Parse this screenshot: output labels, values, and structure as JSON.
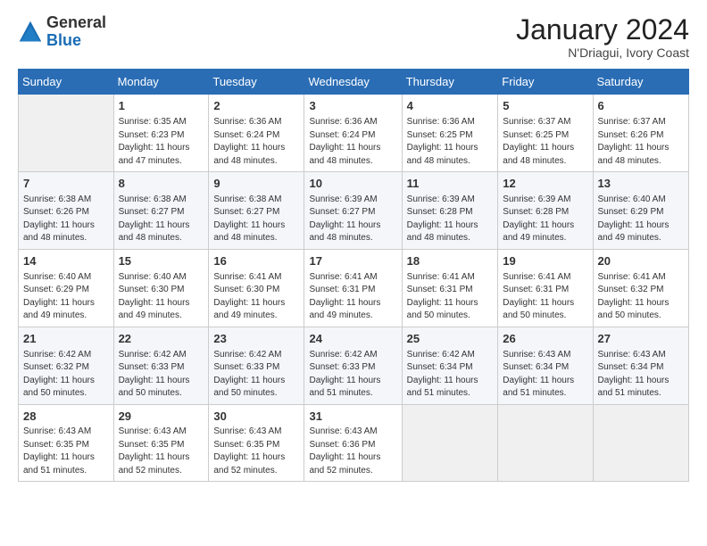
{
  "logo": {
    "general": "General",
    "blue": "Blue"
  },
  "title": "January 2024",
  "location": "N'Driagui, Ivory Coast",
  "headers": [
    "Sunday",
    "Monday",
    "Tuesday",
    "Wednesday",
    "Thursday",
    "Friday",
    "Saturday"
  ],
  "weeks": [
    [
      {
        "day": "",
        "info": ""
      },
      {
        "day": "1",
        "info": "Sunrise: 6:35 AM\nSunset: 6:23 PM\nDaylight: 11 hours\nand 47 minutes."
      },
      {
        "day": "2",
        "info": "Sunrise: 6:36 AM\nSunset: 6:24 PM\nDaylight: 11 hours\nand 48 minutes."
      },
      {
        "day": "3",
        "info": "Sunrise: 6:36 AM\nSunset: 6:24 PM\nDaylight: 11 hours\nand 48 minutes."
      },
      {
        "day": "4",
        "info": "Sunrise: 6:36 AM\nSunset: 6:25 PM\nDaylight: 11 hours\nand 48 minutes."
      },
      {
        "day": "5",
        "info": "Sunrise: 6:37 AM\nSunset: 6:25 PM\nDaylight: 11 hours\nand 48 minutes."
      },
      {
        "day": "6",
        "info": "Sunrise: 6:37 AM\nSunset: 6:26 PM\nDaylight: 11 hours\nand 48 minutes."
      }
    ],
    [
      {
        "day": "7",
        "info": "Sunrise: 6:38 AM\nSunset: 6:26 PM\nDaylight: 11 hours\nand 48 minutes."
      },
      {
        "day": "8",
        "info": "Sunrise: 6:38 AM\nSunset: 6:27 PM\nDaylight: 11 hours\nand 48 minutes."
      },
      {
        "day": "9",
        "info": "Sunrise: 6:38 AM\nSunset: 6:27 PM\nDaylight: 11 hours\nand 48 minutes."
      },
      {
        "day": "10",
        "info": "Sunrise: 6:39 AM\nSunset: 6:27 PM\nDaylight: 11 hours\nand 48 minutes."
      },
      {
        "day": "11",
        "info": "Sunrise: 6:39 AM\nSunset: 6:28 PM\nDaylight: 11 hours\nand 48 minutes."
      },
      {
        "day": "12",
        "info": "Sunrise: 6:39 AM\nSunset: 6:28 PM\nDaylight: 11 hours\nand 49 minutes."
      },
      {
        "day": "13",
        "info": "Sunrise: 6:40 AM\nSunset: 6:29 PM\nDaylight: 11 hours\nand 49 minutes."
      }
    ],
    [
      {
        "day": "14",
        "info": "Sunrise: 6:40 AM\nSunset: 6:29 PM\nDaylight: 11 hours\nand 49 minutes."
      },
      {
        "day": "15",
        "info": "Sunrise: 6:40 AM\nSunset: 6:30 PM\nDaylight: 11 hours\nand 49 minutes."
      },
      {
        "day": "16",
        "info": "Sunrise: 6:41 AM\nSunset: 6:30 PM\nDaylight: 11 hours\nand 49 minutes."
      },
      {
        "day": "17",
        "info": "Sunrise: 6:41 AM\nSunset: 6:31 PM\nDaylight: 11 hours\nand 49 minutes."
      },
      {
        "day": "18",
        "info": "Sunrise: 6:41 AM\nSunset: 6:31 PM\nDaylight: 11 hours\nand 50 minutes."
      },
      {
        "day": "19",
        "info": "Sunrise: 6:41 AM\nSunset: 6:31 PM\nDaylight: 11 hours\nand 50 minutes."
      },
      {
        "day": "20",
        "info": "Sunrise: 6:41 AM\nSunset: 6:32 PM\nDaylight: 11 hours\nand 50 minutes."
      }
    ],
    [
      {
        "day": "21",
        "info": "Sunrise: 6:42 AM\nSunset: 6:32 PM\nDaylight: 11 hours\nand 50 minutes."
      },
      {
        "day": "22",
        "info": "Sunrise: 6:42 AM\nSunset: 6:33 PM\nDaylight: 11 hours\nand 50 minutes."
      },
      {
        "day": "23",
        "info": "Sunrise: 6:42 AM\nSunset: 6:33 PM\nDaylight: 11 hours\nand 50 minutes."
      },
      {
        "day": "24",
        "info": "Sunrise: 6:42 AM\nSunset: 6:33 PM\nDaylight: 11 hours\nand 51 minutes."
      },
      {
        "day": "25",
        "info": "Sunrise: 6:42 AM\nSunset: 6:34 PM\nDaylight: 11 hours\nand 51 minutes."
      },
      {
        "day": "26",
        "info": "Sunrise: 6:43 AM\nSunset: 6:34 PM\nDaylight: 11 hours\nand 51 minutes."
      },
      {
        "day": "27",
        "info": "Sunrise: 6:43 AM\nSunset: 6:34 PM\nDaylight: 11 hours\nand 51 minutes."
      }
    ],
    [
      {
        "day": "28",
        "info": "Sunrise: 6:43 AM\nSunset: 6:35 PM\nDaylight: 11 hours\nand 51 minutes."
      },
      {
        "day": "29",
        "info": "Sunrise: 6:43 AM\nSunset: 6:35 PM\nDaylight: 11 hours\nand 52 minutes."
      },
      {
        "day": "30",
        "info": "Sunrise: 6:43 AM\nSunset: 6:35 PM\nDaylight: 11 hours\nand 52 minutes."
      },
      {
        "day": "31",
        "info": "Sunrise: 6:43 AM\nSunset: 6:36 PM\nDaylight: 11 hours\nand 52 minutes."
      },
      {
        "day": "",
        "info": ""
      },
      {
        "day": "",
        "info": ""
      },
      {
        "day": "",
        "info": ""
      }
    ]
  ]
}
